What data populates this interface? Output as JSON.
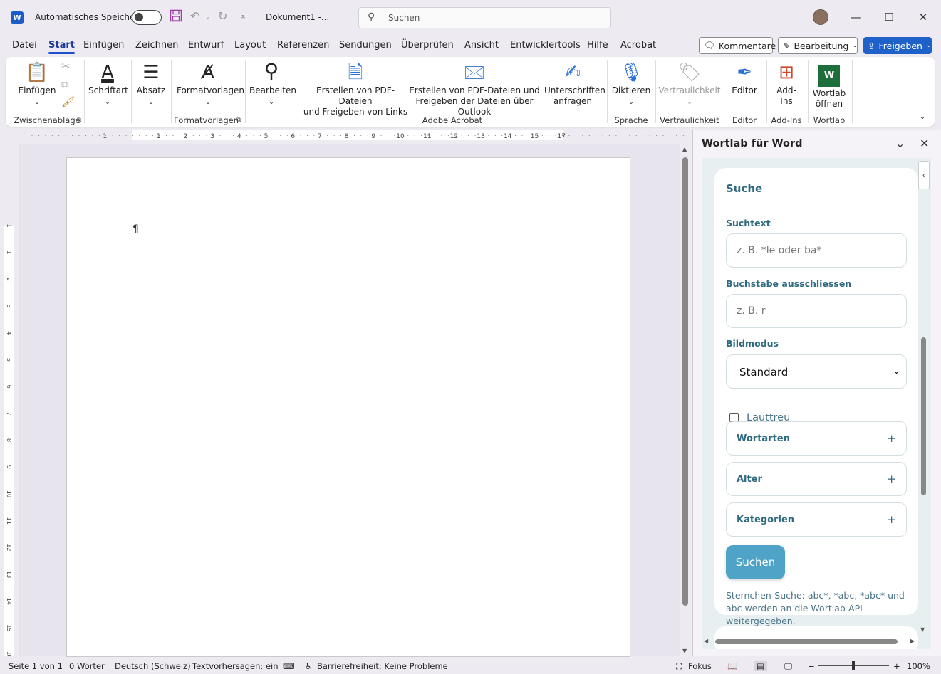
{
  "titlebar": {
    "autosave_label": "Automatisches Speichern",
    "doc_title": "Dokument1  -...",
    "search_placeholder": "Suchen",
    "app_logo": "W"
  },
  "menu": {
    "items": [
      "Datei",
      "Start",
      "Einfügen",
      "Zeichnen",
      "Entwurf",
      "Layout",
      "Referenzen",
      "Sendungen",
      "Überprüfen",
      "Ansicht",
      "Entwicklertools",
      "Hilfe",
      "Acrobat"
    ],
    "active": "Start",
    "comment_label": "Kommentare",
    "edit_label": "Bearbeitung",
    "share_label": "Freigeben"
  },
  "ribbon": {
    "paste": "Einfügen",
    "font": "Schriftart",
    "paragraph": "Absatz",
    "styles": "Formatvorlagen",
    "editing": "Bearbeiten",
    "pdf_links_1": "Erstellen von PDF-Dateien",
    "pdf_links_2": "und Freigeben von Links",
    "pdf_outlook_1": "Erstellen von PDF-Dateien und",
    "pdf_outlook_2": "Freigeben der Dateien über Outlook",
    "signatures_1": "Unterschriften",
    "signatures_2": "anfragen",
    "dictate": "Diktieren",
    "sensitivity": "Vertraulichkeit",
    "editor": "Editor",
    "addins_1": "Add-",
    "addins_2": "Ins",
    "wortlab_1": "Wortlab",
    "wortlab_2": "öffnen",
    "wortlab_logo": "W",
    "groups": {
      "clipboard": "Zwischenablage",
      "styles": "Formatvorlagen",
      "acrobat": "Adobe Acrobat",
      "voice": "Sprache",
      "sensitivity": "Vertraulichkeit",
      "editor": "Editor",
      "addins": "Add-Ins",
      "wortlab": "Wortlab"
    }
  },
  "document": {
    "pilcrow": "¶"
  },
  "panel": {
    "title": "Wortlab für Word",
    "card_title": "Suche",
    "search_label": "Suchtext",
    "search_placeholder": "z. B. *le oder ba*",
    "exclude_label": "Buchstabe ausschliessen",
    "exclude_placeholder": "z. B. r",
    "image_mode_label": "Bildmodus",
    "image_mode_value": "Standard",
    "phonetic_label": "Lauttreu",
    "accordions": [
      "Wortarten",
      "Alter",
      "Kategorien"
    ],
    "search_button": "Suchen",
    "hint": "Sternchen-Suche: abc*, *abc, *abc* und abc werden an die Wortlab-API weitergegeben."
  },
  "status": {
    "page": "Seite 1 von 1",
    "words": "0 Wörter",
    "language": "Deutsch (Schweiz)",
    "predictions": "Textvorhersagen: ein",
    "accessibility": "Barrierefreiheit: Keine Probleme",
    "focus": "Fokus",
    "zoom": "100%"
  },
  "ruler": {
    "h_labels": [
      "1",
      "1",
      "2",
      "3",
      "4",
      "5",
      "6",
      "7",
      "8",
      "9",
      "10",
      "11",
      "12",
      "13",
      "14",
      "15",
      "17"
    ],
    "v_labels": [
      "1",
      "1",
      "2",
      "3",
      "4",
      "5",
      "6",
      "7",
      "8",
      "9",
      "10",
      "11",
      "12",
      "13",
      "14",
      "15",
      "16"
    ]
  },
  "colors": {
    "accent": "#1e62c9",
    "panel_text": "#2e6a80",
    "search_button": "#4fa3c7"
  }
}
